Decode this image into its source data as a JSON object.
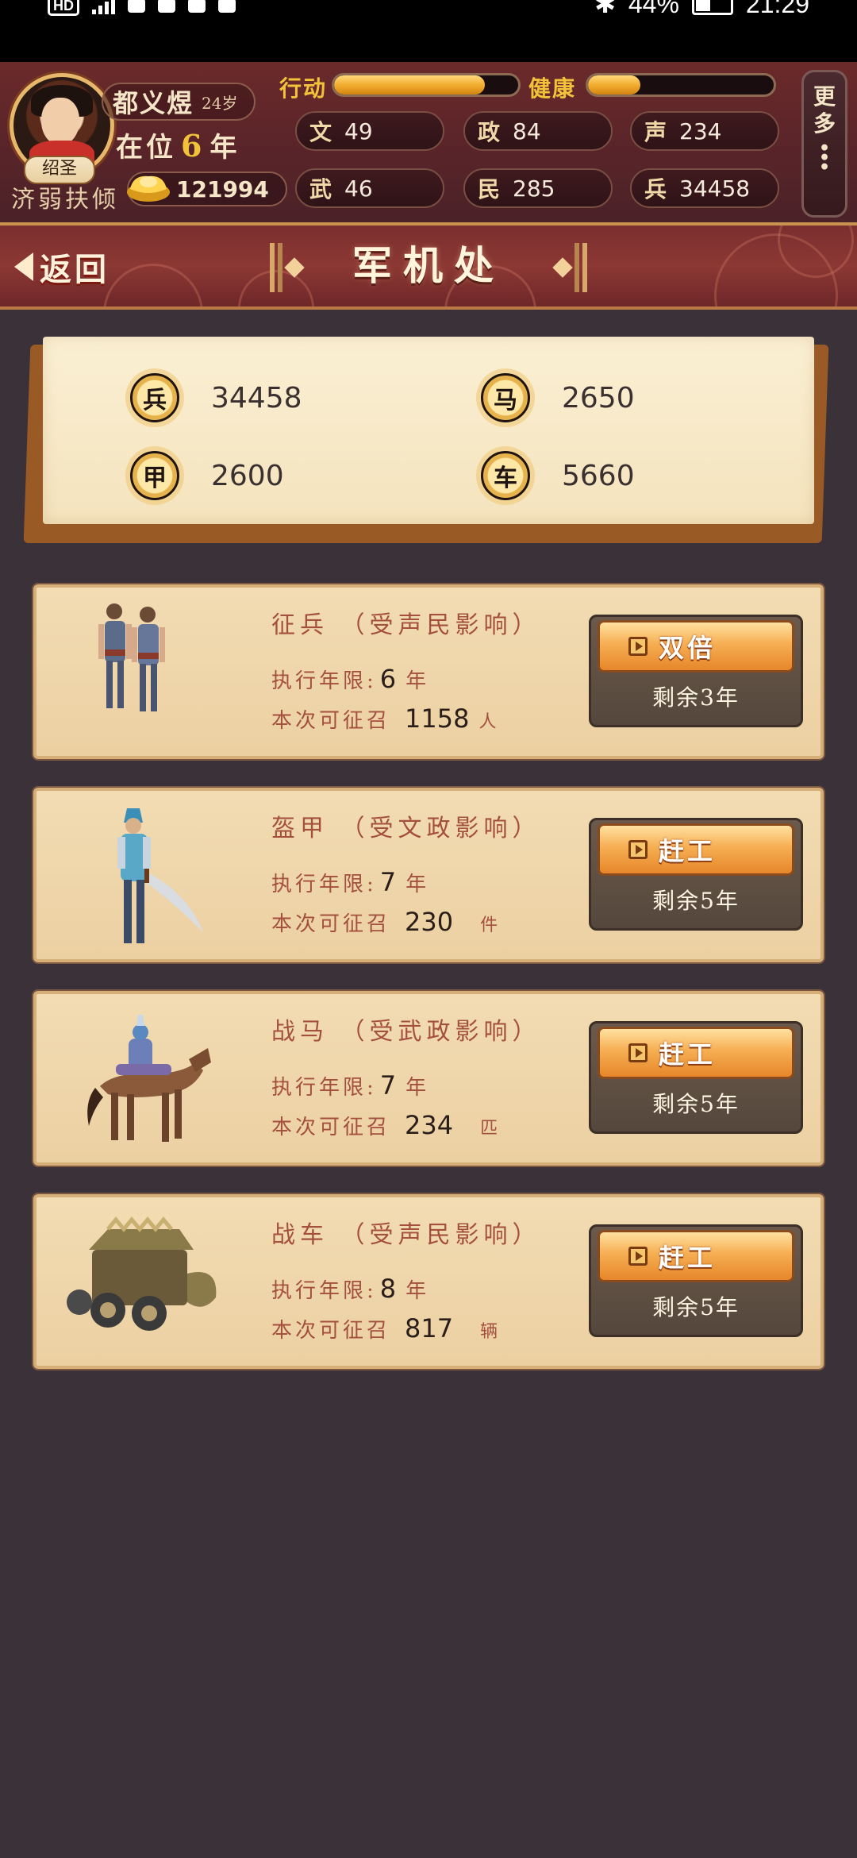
{
  "status_bar": {
    "left_badge": "HD",
    "battery": "44%",
    "time": "21:29"
  },
  "player": {
    "name": "都义煜",
    "age": "24岁",
    "title_badge": "绍圣",
    "reign_prefix": "在位",
    "reign_years": "6",
    "reign_suffix": "年",
    "motto": "济弱扶倾",
    "gold": "121994",
    "action_label": "行动",
    "action_fill": 0.82,
    "health_label": "健康",
    "health_fill": 0.28,
    "stats": [
      {
        "key": "文",
        "value": "49"
      },
      {
        "key": "政",
        "value": "84"
      },
      {
        "key": "声",
        "value": "234"
      },
      {
        "key": "武",
        "value": "46"
      },
      {
        "key": "民",
        "value": "285"
      },
      {
        "key": "兵",
        "value": "34458"
      }
    ],
    "more_label_1": "更",
    "more_label_2": "多"
  },
  "banner": {
    "back_label": "返回",
    "title": "军机处"
  },
  "resources": [
    {
      "icon": "兵",
      "value": "34458"
    },
    {
      "icon": "马",
      "value": "2650"
    },
    {
      "icon": "甲",
      "value": "2600"
    },
    {
      "icon": "车",
      "value": "5660"
    }
  ],
  "recruit_labels": {
    "years_label": "执行年限:",
    "years_unit": "年",
    "recruit_label": "本次可征召"
  },
  "recruits": [
    {
      "name": "征兵",
      "influence": "（受声民影响）",
      "years": "6",
      "amount": "1158",
      "unit": "人",
      "button": "双倍",
      "remaining": "剩余3年"
    },
    {
      "name": "盔甲",
      "influence": "（受文政影响）",
      "years": "7",
      "amount": "230",
      "unit": "件",
      "button": "赶工",
      "remaining": "剩余5年"
    },
    {
      "name": "战马",
      "influence": "（受武政影响）",
      "years": "7",
      "amount": "234",
      "unit": "匹",
      "button": "赶工",
      "remaining": "剩余5年"
    },
    {
      "name": "战车",
      "influence": "（受声民影响）",
      "years": "8",
      "amount": "817",
      "unit": "辆",
      "button": "赶工",
      "remaining": "剩余5年"
    }
  ]
}
